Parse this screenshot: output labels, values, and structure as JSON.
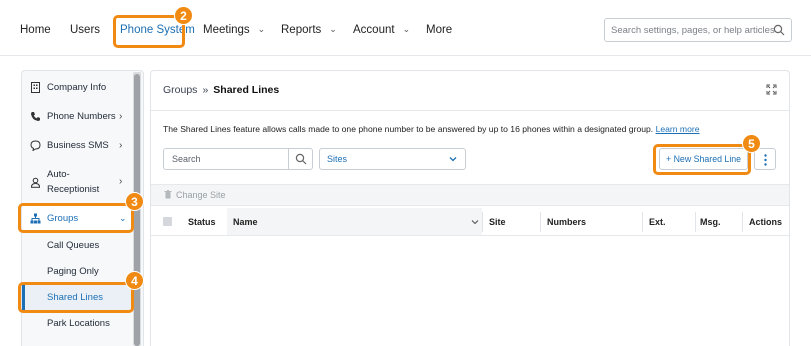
{
  "nav": {
    "items": [
      {
        "label": "Home",
        "chevron": false
      },
      {
        "label": "Users",
        "chevron": false
      },
      {
        "label": "Phone System",
        "chevron": false,
        "active": true
      },
      {
        "label": "Meetings",
        "chevron": true
      },
      {
        "label": "Reports",
        "chevron": true
      },
      {
        "label": "Account",
        "chevron": true
      },
      {
        "label": "More",
        "chevron": false
      }
    ],
    "search_placeholder": "Search settings, pages, or help articles"
  },
  "callouts": [
    "2",
    "3",
    "4",
    "5"
  ],
  "sidebar": {
    "items": [
      {
        "label": "Company Info",
        "icon": "building-icon"
      },
      {
        "label": "Phone Numbers",
        "icon": "phone-icon",
        "chevron": ">"
      },
      {
        "label": "Business SMS",
        "icon": "chat-bubble-icon",
        "chevron": ">"
      },
      {
        "label": "Auto-",
        "label2": "Receptionist",
        "icon": "receptionist-icon",
        "chevron": ">"
      },
      {
        "label": "Groups",
        "icon": "org-chart-icon",
        "chevron": "v",
        "active": true
      }
    ],
    "subitems": [
      "Call Queues",
      "Paging Only",
      "Shared Lines",
      "Park Locations"
    ],
    "active_subitem": "Shared Lines"
  },
  "main": {
    "breadcrumb": {
      "parent": "Groups",
      "separator": "»",
      "current": "Shared Lines"
    },
    "description": "The Shared Lines feature allows calls made to one phone number to be answered by up to 16 phones within a designated group.",
    "learn_more": "Learn more",
    "search_placeholder": "Search",
    "sites_value": "Sites",
    "new_button": "+ New Shared Line",
    "change_site": "Change Site",
    "columns": [
      "Status",
      "Name",
      "Site",
      "Numbers",
      "Ext.",
      "Msg.",
      "Actions"
    ]
  },
  "colors": {
    "accent": "#1c6fb5",
    "callout": "#f08a12"
  }
}
